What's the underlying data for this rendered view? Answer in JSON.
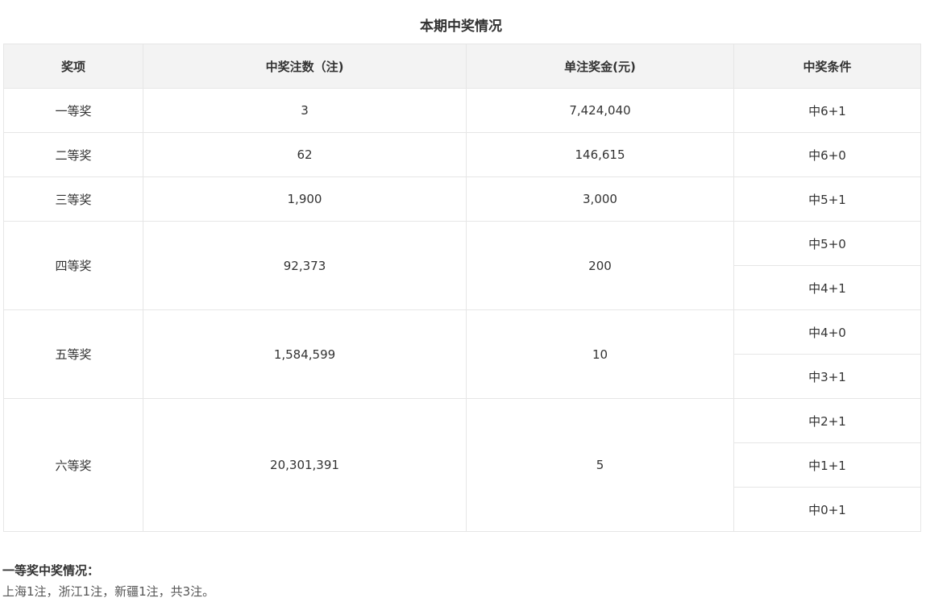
{
  "title": "本期中奖情况",
  "table": {
    "headers": [
      "奖项",
      "中奖注数（注)",
      "单注奖金(元)",
      "中奖条件"
    ],
    "rows": [
      {
        "level": "一等奖",
        "count": "3",
        "prize": "7,424,040",
        "conditions": [
          "中6+1"
        ]
      },
      {
        "level": "二等奖",
        "count": "62",
        "prize": "146,615",
        "conditions": [
          "中6+0"
        ]
      },
      {
        "level": "三等奖",
        "count": "1,900",
        "prize": "3,000",
        "conditions": [
          "中5+1"
        ]
      },
      {
        "level": "四等奖",
        "count": "92,373",
        "prize": "200",
        "conditions": [
          "中5+0",
          "中4+1"
        ]
      },
      {
        "level": "五等奖",
        "count": "1,584,599",
        "prize": "10",
        "conditions": [
          "中4+0",
          "中3+1"
        ]
      },
      {
        "level": "六等奖",
        "count": "20,301,391",
        "prize": "5",
        "conditions": [
          "中2+1",
          "中1+1",
          "中0+1"
        ]
      }
    ]
  },
  "summary": {
    "heading": "一等奖中奖情况：",
    "text": "上海1注，浙江1注，新疆1注，共3注。"
  }
}
